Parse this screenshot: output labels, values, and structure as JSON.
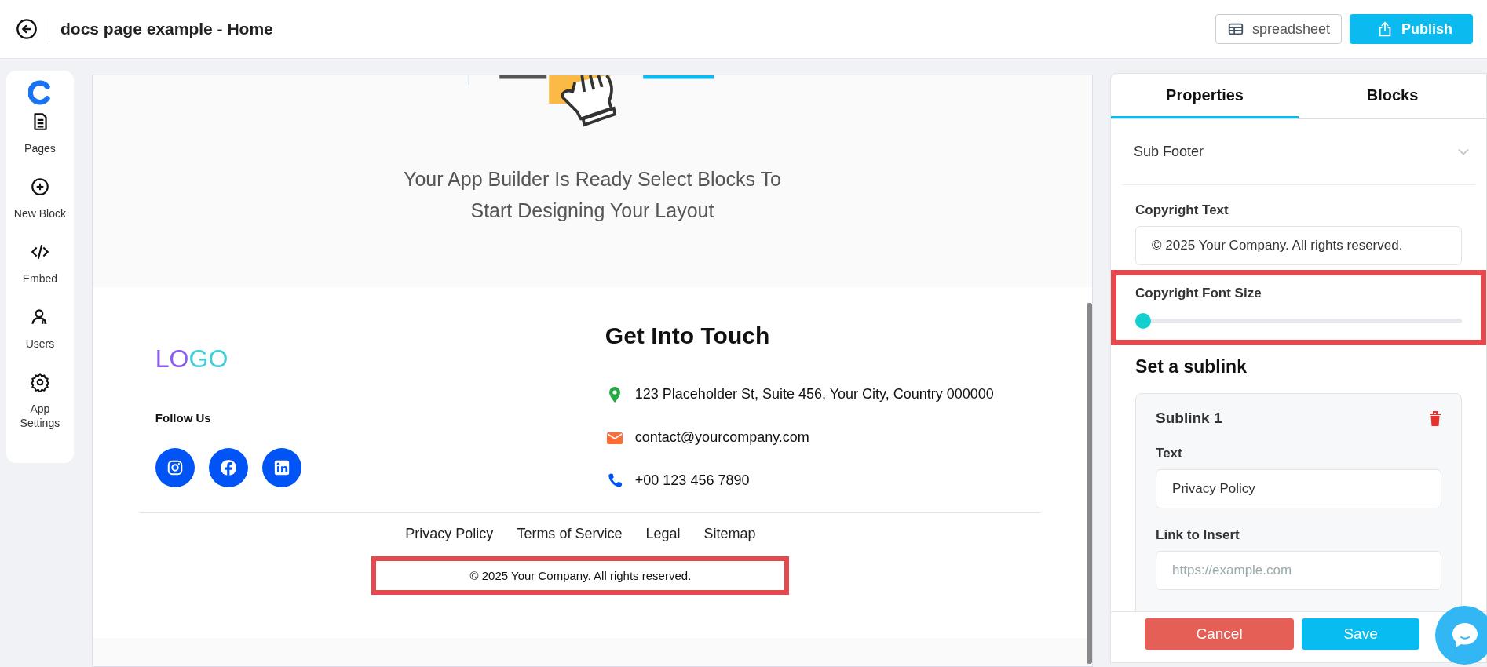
{
  "header": {
    "title": "docs page example - Home",
    "buttons": [
      {
        "label": "spreadsheet",
        "kind": "outline"
      },
      {
        "label": "Publish",
        "kind": "primary"
      }
    ]
  },
  "sidebar": {
    "items": [
      {
        "label": "Pages"
      },
      {
        "label": "New Block"
      },
      {
        "label": "Embed"
      },
      {
        "label": "Users"
      },
      {
        "label": "App Settings"
      }
    ]
  },
  "canvas": {
    "message": "Your App Builder Is Ready Select Blocks To Start Designing Your Layout",
    "footer": {
      "logo": "LOGO",
      "follow_label": "Follow Us",
      "social": [
        {
          "kind": "instagram"
        },
        {
          "kind": "facebook"
        },
        {
          "kind": "linkedin"
        }
      ],
      "contact_title": "Get Into Touch",
      "contacts": [
        {
          "kind": "address",
          "text": "123 Placeholder St, Suite 456, Your City, Country 000000"
        },
        {
          "kind": "email",
          "text": "contact@yourcompany.com"
        },
        {
          "kind": "phone",
          "text": "+00 123 456 7890"
        }
      ],
      "links": [
        "Privacy Policy",
        "Terms of Service",
        "Legal",
        "Sitemap"
      ],
      "copyright": {
        "text": "© 2025 Your Company. All rights reserved.",
        "highlighted": true
      }
    }
  },
  "panel": {
    "tabs": [
      {
        "label": "Properties",
        "selected": true
      },
      {
        "label": "Blocks",
        "selected": false
      }
    ],
    "section": "Sub Footer",
    "copyright_text": {
      "label": "Copyright Text",
      "value": "© 2025 Your Company. All rights reserved."
    },
    "font_size": {
      "label": "Copyright Font Size",
      "level": 0,
      "highlighted": true
    },
    "sublinks_title": "Set a sublink",
    "sublinks": [
      {
        "title": "Sublink 1",
        "fields": [
          {
            "label": "Text",
            "value": "Privacy Policy"
          },
          {
            "label": "Link to Insert",
            "placeholder": "https://example.com"
          }
        ]
      }
    ],
    "actions": [
      {
        "label": "Cancel",
        "kind": "cancel"
      },
      {
        "label": "Save",
        "kind": "save"
      }
    ]
  }
}
